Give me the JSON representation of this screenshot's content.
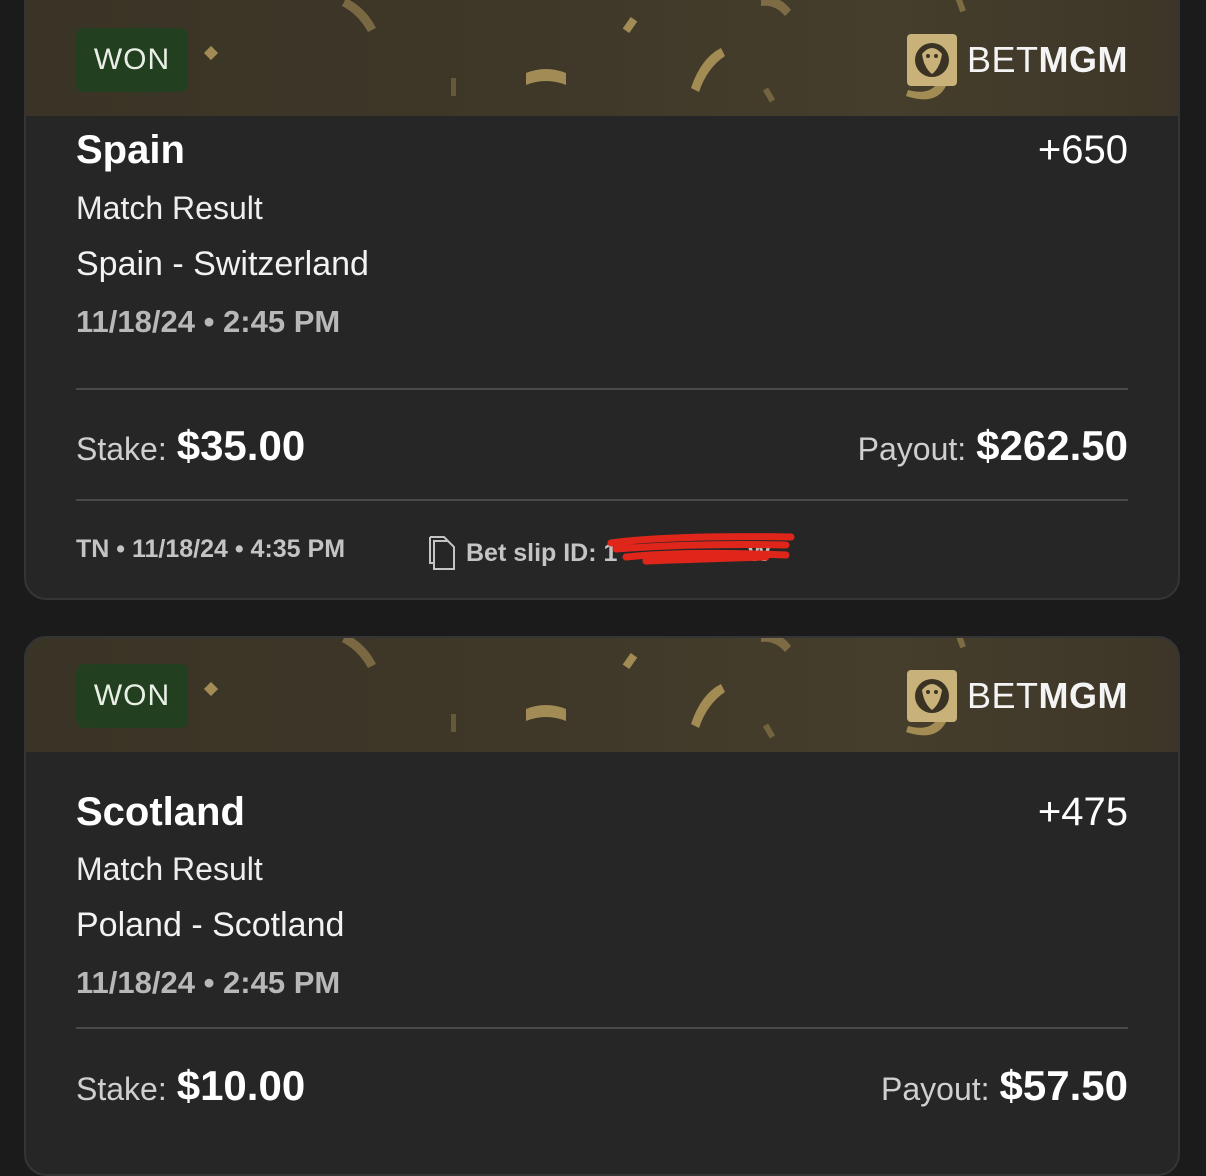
{
  "bets": [
    {
      "status": "WON",
      "brand_bet": "BET",
      "brand_mgm": "MGM",
      "selection": "Spain",
      "odds": "+650",
      "market": "Match Result",
      "event": "Spain - Switzerland",
      "event_datetime": "11/18/24 • 2:45 PM",
      "stake_label": "Stake:",
      "stake": "$35.00",
      "payout_label": "Payout:",
      "payout": "$262.50",
      "placed_info": "TN • 11/18/24 • 4:35 PM",
      "bet_slip_label": "Bet slip ID: 1",
      "bet_slip_tail": "W"
    },
    {
      "status": "WON",
      "brand_bet": "BET",
      "brand_mgm": "MGM",
      "selection": "Scotland",
      "odds": "+475",
      "market": "Match Result",
      "event": "Poland - Scotland",
      "event_datetime": "11/18/24 • 2:45 PM",
      "stake_label": "Stake:",
      "stake": "$10.00",
      "payout_label": "Payout:",
      "payout": "$57.50"
    }
  ],
  "colors": {
    "won_badge_bg": "#22401f",
    "card_bg": "#262626",
    "page_bg": "#1b1b1b",
    "gold_confetti": "#b49a5c",
    "redaction": "#e0261b"
  },
  "icons": [
    "bet-slip-copy-icon",
    "betmgm-lion-logo"
  ]
}
